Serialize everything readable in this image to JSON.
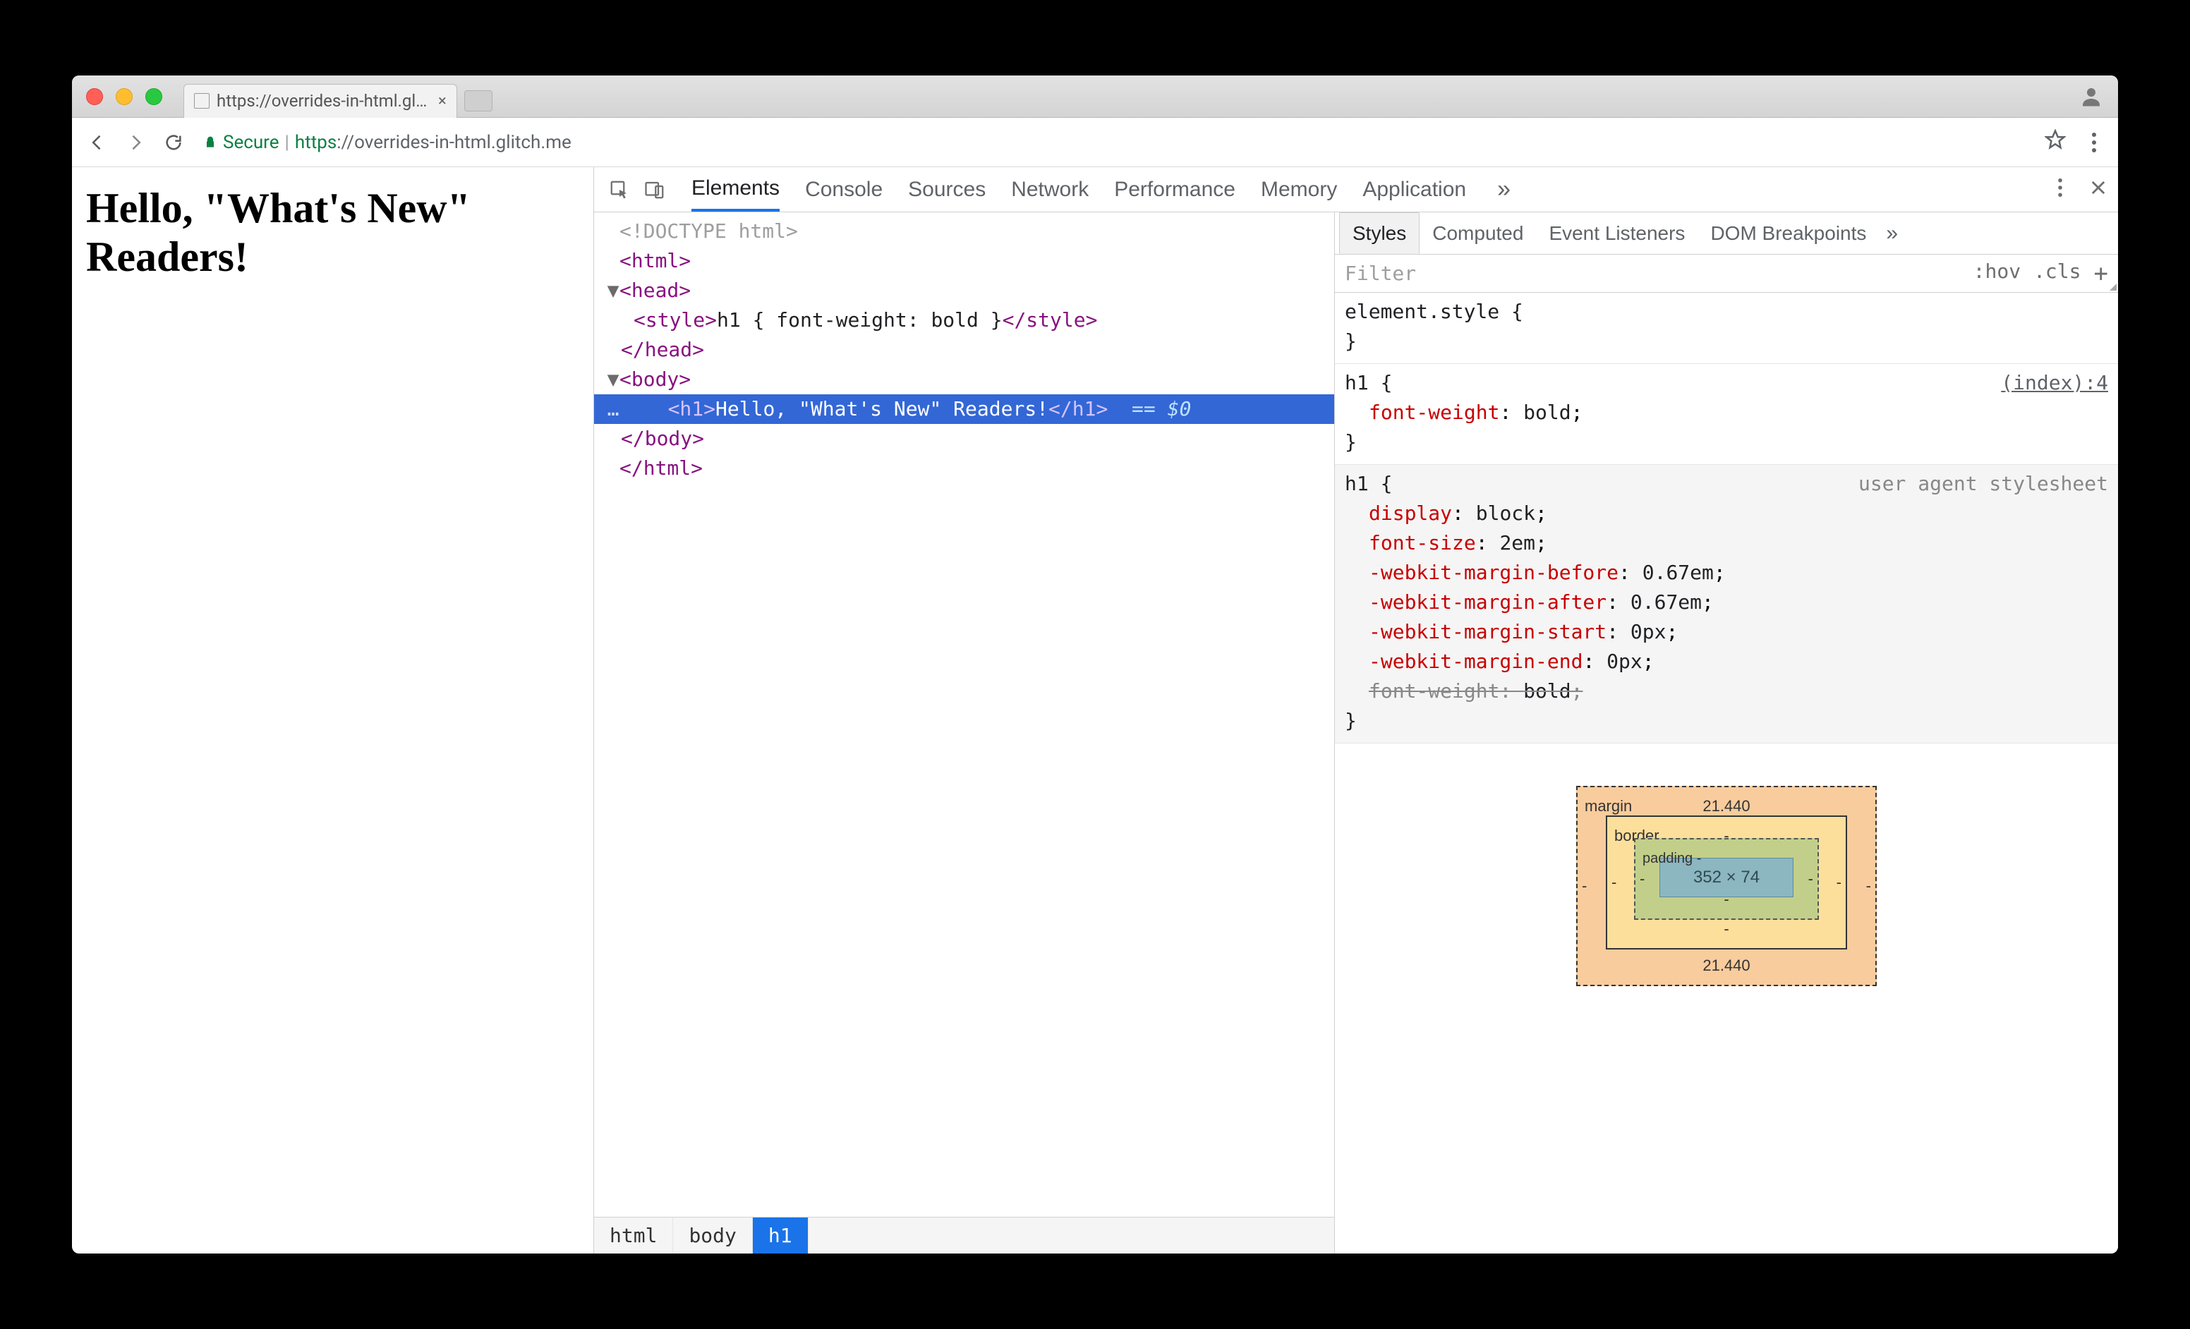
{
  "tab": {
    "title": "https://overrides-in-html.glitch",
    "close_glyph": "×"
  },
  "addr": {
    "secure_label": "Secure",
    "url_proto": "https",
    "url_rest": "://overrides-in-html.glitch.me"
  },
  "page": {
    "heading": "Hello, \"What's New\" Readers!"
  },
  "devtools": {
    "tabs": [
      "Elements",
      "Console",
      "Sources",
      "Network",
      "Performance",
      "Memory",
      "Application"
    ],
    "more_glyph": "»",
    "tree": {
      "doctype": "<!DOCTYPE html>",
      "html_open": "<html>",
      "head_open": "<head>",
      "style_line_open": "<style>",
      "style_text": "h1 { font-weight: bold }",
      "style_line_close": "</style>",
      "head_close": "</head>",
      "body_open": "<body>",
      "h1_open": "<h1>",
      "h1_text": "Hello, \"What's New\" Readers!",
      "h1_close": "</h1>",
      "eq0": "== $0",
      "body_close": "</body>",
      "html_close": "</html>",
      "gutter_ellipsis": "…"
    },
    "crumbs": [
      "html",
      "body",
      "h1"
    ],
    "styles": {
      "tabs": [
        "Styles",
        "Computed",
        "Event Listeners",
        "DOM Breakpoints"
      ],
      "more_glyph": "»",
      "filter_placeholder": "Filter",
      "hov_label": ":hov",
      "cls_label": ".cls",
      "plus_glyph": "+",
      "rules": {
        "elstyle_selector": "element.style",
        "r1": {
          "selector": "h1",
          "origin": "(index):4",
          "decls": [
            {
              "prop": "font-weight",
              "val": "bold"
            }
          ]
        },
        "r2": {
          "selector": "h1",
          "origin": "user agent stylesheet",
          "decls": [
            {
              "prop": "display",
              "val": "block"
            },
            {
              "prop": "font-size",
              "val": "2em"
            },
            {
              "prop": "-webkit-margin-before",
              "val": "0.67em"
            },
            {
              "prop": "-webkit-margin-after",
              "val": "0.67em"
            },
            {
              "prop": "-webkit-margin-start",
              "val": "0px"
            },
            {
              "prop": "-webkit-margin-end",
              "val": "0px"
            },
            {
              "prop": "font-weight",
              "val": "bold",
              "over": true
            }
          ]
        }
      },
      "boxmodel": {
        "margin_label": "margin",
        "border_label": "border",
        "padding_label": "padding",
        "margin_top": "21.440",
        "margin_bottom": "21.440",
        "margin_left": "-",
        "margin_right": "-",
        "border_dash": "-",
        "padding_top_dash": "-",
        "padding_bottom_dash": "-",
        "content": "352 × 74"
      }
    }
  }
}
